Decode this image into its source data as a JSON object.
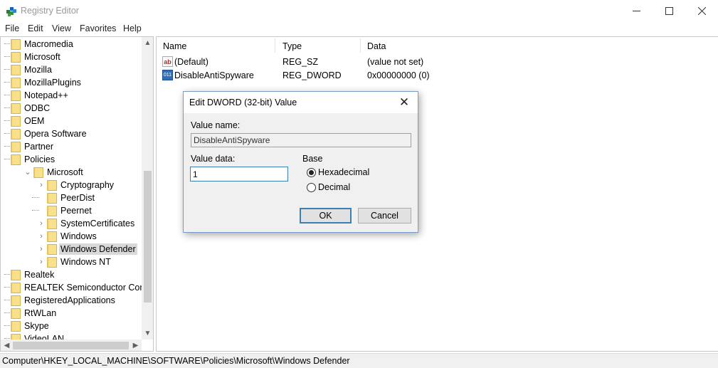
{
  "window": {
    "title": "Registry Editor",
    "minimize_glyph": "—",
    "maximize_glyph": "☐",
    "close_glyph": "✕"
  },
  "menu": [
    "File",
    "Edit",
    "View",
    "Favorites",
    "Help"
  ],
  "tree": {
    "items": [
      {
        "label": "Macromedia",
        "level": 1,
        "expander": "",
        "selected": false
      },
      {
        "label": "Microsoft",
        "level": 1,
        "expander": "",
        "selected": false
      },
      {
        "label": "Mozilla",
        "level": 1,
        "expander": "",
        "selected": false
      },
      {
        "label": "MozillaPlugins",
        "level": 1,
        "expander": "",
        "selected": false
      },
      {
        "label": "Notepad++",
        "level": 1,
        "expander": "",
        "selected": false
      },
      {
        "label": "ODBC",
        "level": 1,
        "expander": "",
        "selected": false
      },
      {
        "label": "OEM",
        "level": 1,
        "expander": "",
        "selected": false
      },
      {
        "label": "Opera Software",
        "level": 1,
        "expander": "",
        "selected": false
      },
      {
        "label": "Partner",
        "level": 1,
        "expander": "",
        "selected": false
      },
      {
        "label": "Policies",
        "level": 1,
        "expander": "",
        "selected": false
      },
      {
        "label": "Microsoft",
        "level": 2,
        "expander": "expanded",
        "selected": false
      },
      {
        "label": "Cryptography",
        "level": 3,
        "expander": "collapsed",
        "selected": false
      },
      {
        "label": "PeerDist",
        "level": 3,
        "expander": "",
        "selected": false
      },
      {
        "label": "Peernet",
        "level": 3,
        "expander": "",
        "selected": false
      },
      {
        "label": "SystemCertificates",
        "level": 3,
        "expander": "collapsed",
        "selected": false
      },
      {
        "label": "Windows",
        "level": 3,
        "expander": "collapsed",
        "selected": false
      },
      {
        "label": "Windows Defender",
        "level": 3,
        "expander": "collapsed",
        "selected": true
      },
      {
        "label": "Windows NT",
        "level": 3,
        "expander": "collapsed",
        "selected": false
      },
      {
        "label": "Realtek",
        "level": 1,
        "expander": "",
        "selected": false
      },
      {
        "label": "REALTEK Semiconductor Corp.",
        "level": 1,
        "expander": "",
        "selected": false
      },
      {
        "label": "RegisteredApplications",
        "level": 1,
        "expander": "",
        "selected": false
      },
      {
        "label": "RtWLan",
        "level": 1,
        "expander": "",
        "selected": false
      },
      {
        "label": "Skype",
        "level": 1,
        "expander": "",
        "selected": false
      },
      {
        "label": "VideoLAN",
        "level": 1,
        "expander": "",
        "selected": false
      }
    ]
  },
  "list": {
    "columns": [
      "Name",
      "Type",
      "Data"
    ],
    "rows": [
      {
        "icon": "string-value-icon",
        "icon_glyph": "ab",
        "name": "(Default)",
        "type": "REG_SZ",
        "data": "(value not set)"
      },
      {
        "icon": "binary-value-icon",
        "icon_glyph": "011",
        "name": "DisableAntiSpyware",
        "type": "REG_DWORD",
        "data": "0x00000000 (0)"
      }
    ]
  },
  "statusbar": {
    "path": "Computer\\HKEY_LOCAL_MACHINE\\SOFTWARE\\Policies\\Microsoft\\Windows Defender"
  },
  "dialog": {
    "title": "Edit DWORD (32-bit) Value",
    "close_glyph": "✕",
    "value_name_label": "Value name:",
    "value_name": "DisableAntiSpyware",
    "value_data_label": "Value data:",
    "value_data": "1",
    "base_label": "Base",
    "base_options": [
      {
        "label": "Hexadecimal",
        "checked": true
      },
      {
        "label": "Decimal",
        "checked": false
      }
    ],
    "ok_label": "OK",
    "cancel_label": "Cancel"
  }
}
